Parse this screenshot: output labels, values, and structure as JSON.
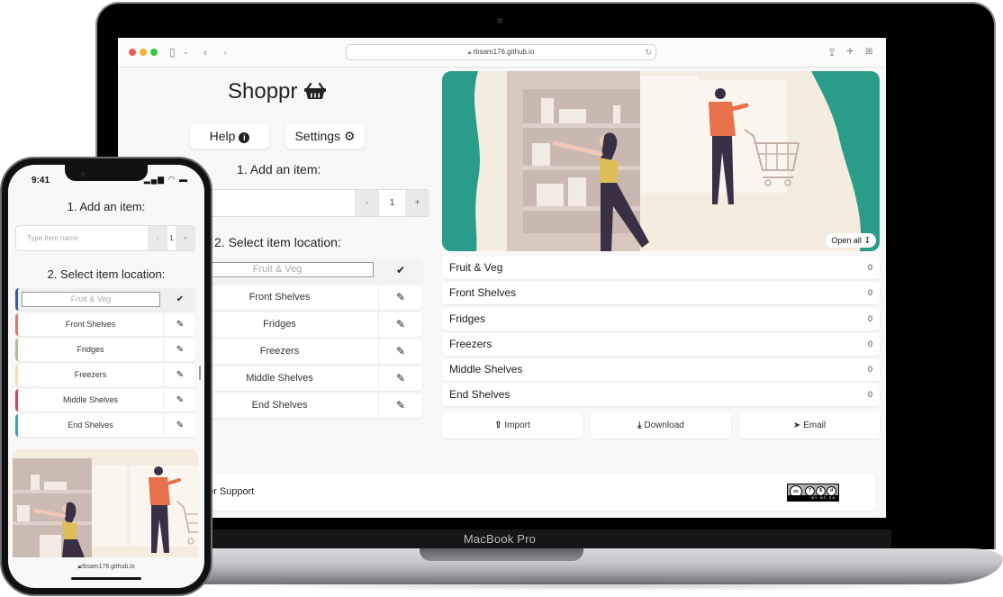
{
  "laptop": {
    "model_label": "MacBook Pro",
    "browser": {
      "url": "rbsam176.github.io",
      "icons": [
        "sidebar-icon",
        "chevron-down-icon",
        "back-icon",
        "forward-icon",
        "reload-icon",
        "share-icon",
        "new-tab-icon",
        "tab-overview-icon"
      ]
    },
    "app": {
      "logo": "Shoppr",
      "help_label": "Help",
      "settings_label": "Settings",
      "step1_heading": "1. Add an item:",
      "item_input_value": "",
      "qty_minus": "-",
      "qty_value": "1",
      "qty_plus": "+",
      "step2_heading": "2. Select item location:",
      "locations": [
        {
          "name": "Fruit & Veg",
          "editing": true,
          "action_icon": "check-icon"
        },
        {
          "name": "Front Shelves",
          "editing": false,
          "action_icon": "pencil-icon"
        },
        {
          "name": "Fridges",
          "editing": false,
          "action_icon": "pencil-icon"
        },
        {
          "name": "Freezers",
          "editing": false,
          "action_icon": "pencil-icon"
        },
        {
          "name": "Middle Shelves",
          "editing": false,
          "action_icon": "pencil-icon"
        },
        {
          "name": "End Shelves",
          "editing": false,
          "action_icon": "pencil-icon"
        }
      ],
      "open_all_label": "Open all",
      "summary": [
        {
          "name": "Fruit & Veg",
          "count": "0"
        },
        {
          "name": "Front Shelves",
          "count": "0"
        },
        {
          "name": "Fridges",
          "count": "0"
        },
        {
          "name": "Freezers",
          "count": "0"
        },
        {
          "name": "Middle Shelves",
          "count": "0"
        },
        {
          "name": "End Shelves",
          "count": "0"
        }
      ],
      "actions": {
        "import_label": "Import",
        "download_label": "Download",
        "email_label": "Email"
      },
      "footer_text": "or Support",
      "license_badge": "BY NC SA"
    }
  },
  "phone": {
    "time": "9:41",
    "step1_heading": "1. Add an item:",
    "item_placeholder": "Type item name",
    "qty_minus": "-",
    "qty_value": "1",
    "qty_plus": "+",
    "step2_heading": "2. Select item location:",
    "locations": [
      {
        "name": "Fruit & Veg",
        "color": "#2f5fa6"
      },
      {
        "name": "Front Shelves",
        "color": "#e07a62"
      },
      {
        "name": "Fridges",
        "color": "#a8c08e"
      },
      {
        "name": "Freezers",
        "color": "#f3e1b4"
      },
      {
        "name": "Middle Shelves",
        "color": "#d2445e"
      },
      {
        "name": "End Shelves",
        "color": "#3fa0bd"
      }
    ],
    "url": "rbsam176.github.io"
  },
  "colors": {
    "hero_teal": "#2a9d8a",
    "hero_cream": "#f5ece0",
    "person_shirt": "#e8704a",
    "person_top_yellow": "#e0be57",
    "dark_figure": "#3a2f44"
  }
}
